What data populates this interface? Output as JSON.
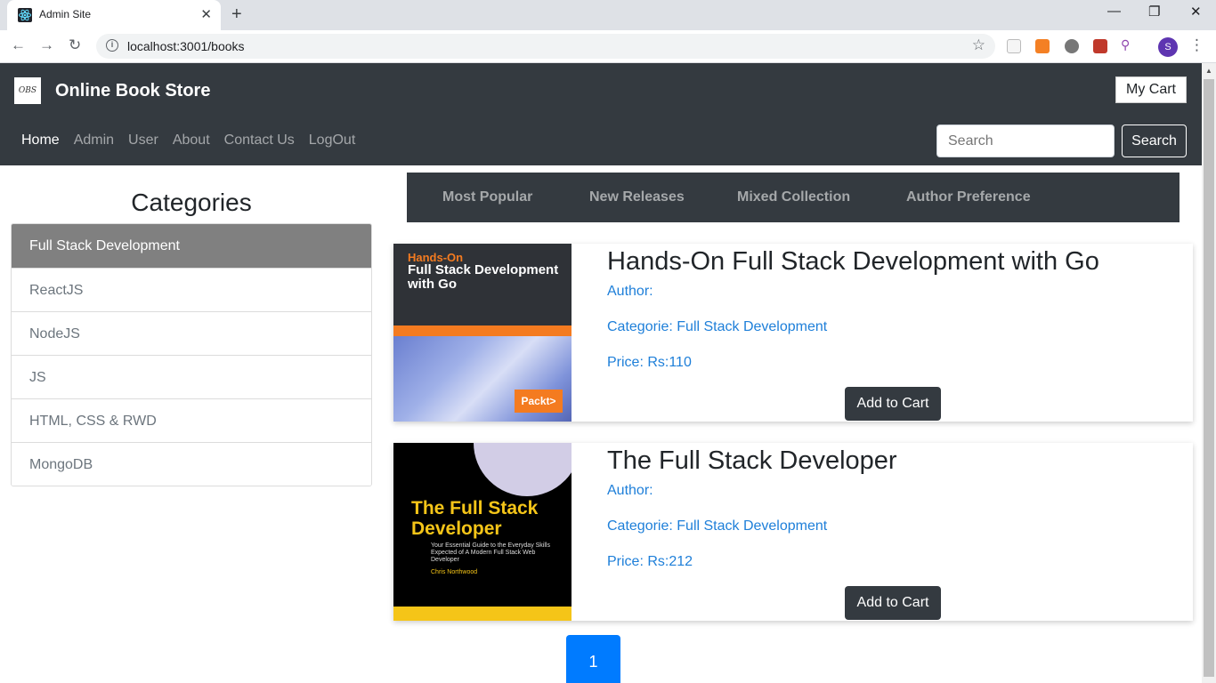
{
  "browser": {
    "tab_title": "Admin Site",
    "url": "localhost:3001/books",
    "profile_initial": "S"
  },
  "navbar": {
    "brand": "Online Book Store",
    "logo_text": "OBS",
    "cart_label": "My Cart",
    "links": [
      "Home",
      "Admin",
      "User",
      "About",
      "Contact Us",
      "LogOut"
    ],
    "search_placeholder": "Search",
    "search_button": "Search"
  },
  "sidebar": {
    "title": "Categories",
    "items": [
      "Full Stack Development",
      "ReactJS",
      "NodeJS",
      "JS",
      "HTML, CSS & RWD",
      "MongoDB"
    ]
  },
  "filters": [
    "Most Popular",
    "New Releases",
    "Mixed Collection",
    "Author Preference"
  ],
  "books": [
    {
      "title": "Hands-On Full Stack Development with Go",
      "author": "Author:",
      "category": "Categorie: Full Stack Development",
      "price": "Price: Rs:110",
      "button": "Add to Cart",
      "cover_heading": "Hands-On",
      "cover_title": "Full Stack Development with Go",
      "cover_publisher": "Packt>"
    },
    {
      "title": "The Full Stack Developer",
      "author": "Author:",
      "category": "Categorie: Full Stack Development",
      "price": "Price: Rs:212",
      "button": "Add to Cart",
      "cover_title": "The Full Stack Developer",
      "cover_subtitle": "Your Essential Guide to the Everyday Skills Expected of A Modern Full Stack Web Developer",
      "cover_author": "Chris Northwood"
    }
  ],
  "pagination": {
    "current": "1"
  },
  "colors": {
    "navbar": "#343a40",
    "link": "#1e7fd9",
    "active_page": "#007bff",
    "active_category": "#808080"
  }
}
